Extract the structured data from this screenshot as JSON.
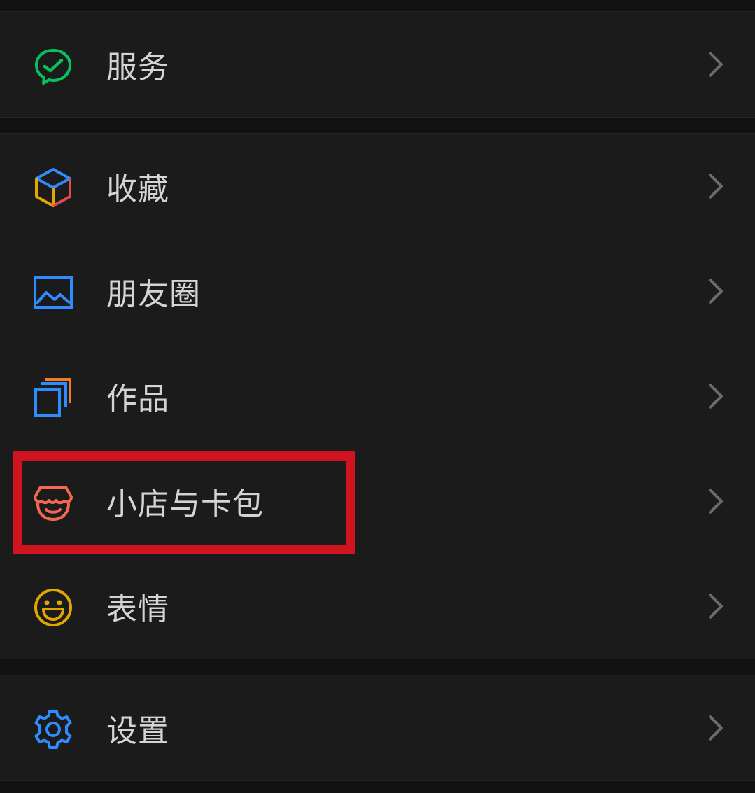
{
  "menu": {
    "groups": [
      {
        "items": [
          {
            "label": "服务",
            "icon": "service-chat-check-icon",
            "color": "#07c160"
          }
        ]
      },
      {
        "items": [
          {
            "label": "收藏",
            "icon": "favorites-cube-icon",
            "color": "#2f8cff"
          },
          {
            "label": "朋友圈",
            "icon": "moments-picture-icon",
            "color": "#2f8cff"
          },
          {
            "label": "作品",
            "icon": "works-cards-icon",
            "color": "#2f8cff"
          },
          {
            "label": "小店与卡包",
            "icon": "shop-cards-icon",
            "color": "#f2674f"
          },
          {
            "label": "表情",
            "icon": "sticker-smile-icon",
            "color": "#e3a600"
          }
        ]
      },
      {
        "items": [
          {
            "label": "设置",
            "icon": "settings-gear-icon",
            "color": "#2f8cff"
          }
        ]
      }
    ],
    "highlight_color": "#d0141f",
    "chevron_color": "#6b6b6b"
  }
}
